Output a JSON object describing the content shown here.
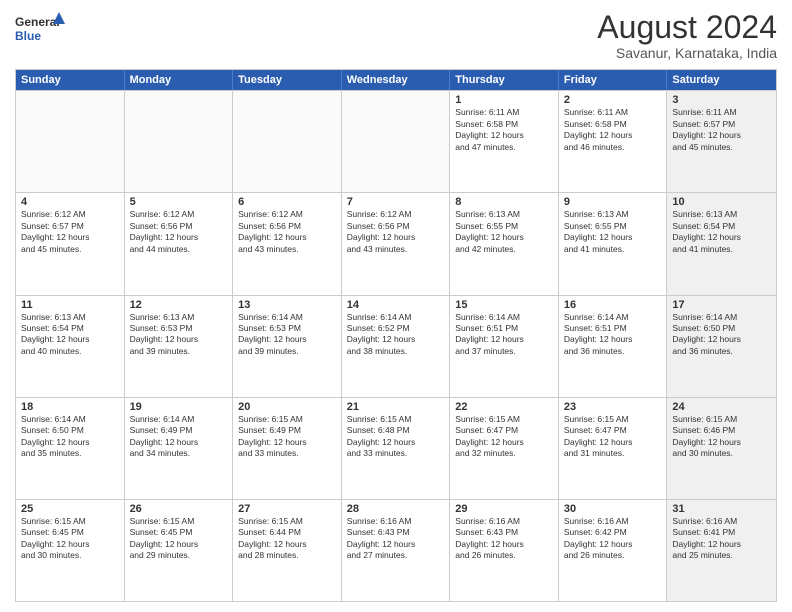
{
  "logo": {
    "line1": "General",
    "line2": "Blue"
  },
  "title": "August 2024",
  "location": "Savanur, Karnataka, India",
  "days": [
    "Sunday",
    "Monday",
    "Tuesday",
    "Wednesday",
    "Thursday",
    "Friday",
    "Saturday"
  ],
  "rows": [
    [
      {
        "num": "",
        "text": "",
        "empty": true
      },
      {
        "num": "",
        "text": "",
        "empty": true
      },
      {
        "num": "",
        "text": "",
        "empty": true
      },
      {
        "num": "",
        "text": "",
        "empty": true
      },
      {
        "num": "1",
        "text": "Sunrise: 6:11 AM\nSunset: 6:58 PM\nDaylight: 12 hours\nand 47 minutes."
      },
      {
        "num": "2",
        "text": "Sunrise: 6:11 AM\nSunset: 6:58 PM\nDaylight: 12 hours\nand 46 minutes."
      },
      {
        "num": "3",
        "text": "Sunrise: 6:11 AM\nSunset: 6:57 PM\nDaylight: 12 hours\nand 45 minutes.",
        "shaded": true
      }
    ],
    [
      {
        "num": "4",
        "text": "Sunrise: 6:12 AM\nSunset: 6:57 PM\nDaylight: 12 hours\nand 45 minutes."
      },
      {
        "num": "5",
        "text": "Sunrise: 6:12 AM\nSunset: 6:56 PM\nDaylight: 12 hours\nand 44 minutes."
      },
      {
        "num": "6",
        "text": "Sunrise: 6:12 AM\nSunset: 6:56 PM\nDaylight: 12 hours\nand 43 minutes."
      },
      {
        "num": "7",
        "text": "Sunrise: 6:12 AM\nSunset: 6:56 PM\nDaylight: 12 hours\nand 43 minutes."
      },
      {
        "num": "8",
        "text": "Sunrise: 6:13 AM\nSunset: 6:55 PM\nDaylight: 12 hours\nand 42 minutes."
      },
      {
        "num": "9",
        "text": "Sunrise: 6:13 AM\nSunset: 6:55 PM\nDaylight: 12 hours\nand 41 minutes."
      },
      {
        "num": "10",
        "text": "Sunrise: 6:13 AM\nSunset: 6:54 PM\nDaylight: 12 hours\nand 41 minutes.",
        "shaded": true
      }
    ],
    [
      {
        "num": "11",
        "text": "Sunrise: 6:13 AM\nSunset: 6:54 PM\nDaylight: 12 hours\nand 40 minutes."
      },
      {
        "num": "12",
        "text": "Sunrise: 6:13 AM\nSunset: 6:53 PM\nDaylight: 12 hours\nand 39 minutes."
      },
      {
        "num": "13",
        "text": "Sunrise: 6:14 AM\nSunset: 6:53 PM\nDaylight: 12 hours\nand 39 minutes."
      },
      {
        "num": "14",
        "text": "Sunrise: 6:14 AM\nSunset: 6:52 PM\nDaylight: 12 hours\nand 38 minutes."
      },
      {
        "num": "15",
        "text": "Sunrise: 6:14 AM\nSunset: 6:51 PM\nDaylight: 12 hours\nand 37 minutes."
      },
      {
        "num": "16",
        "text": "Sunrise: 6:14 AM\nSunset: 6:51 PM\nDaylight: 12 hours\nand 36 minutes."
      },
      {
        "num": "17",
        "text": "Sunrise: 6:14 AM\nSunset: 6:50 PM\nDaylight: 12 hours\nand 36 minutes.",
        "shaded": true
      }
    ],
    [
      {
        "num": "18",
        "text": "Sunrise: 6:14 AM\nSunset: 6:50 PM\nDaylight: 12 hours\nand 35 minutes."
      },
      {
        "num": "19",
        "text": "Sunrise: 6:14 AM\nSunset: 6:49 PM\nDaylight: 12 hours\nand 34 minutes."
      },
      {
        "num": "20",
        "text": "Sunrise: 6:15 AM\nSunset: 6:49 PM\nDaylight: 12 hours\nand 33 minutes."
      },
      {
        "num": "21",
        "text": "Sunrise: 6:15 AM\nSunset: 6:48 PM\nDaylight: 12 hours\nand 33 minutes."
      },
      {
        "num": "22",
        "text": "Sunrise: 6:15 AM\nSunset: 6:47 PM\nDaylight: 12 hours\nand 32 minutes."
      },
      {
        "num": "23",
        "text": "Sunrise: 6:15 AM\nSunset: 6:47 PM\nDaylight: 12 hours\nand 31 minutes."
      },
      {
        "num": "24",
        "text": "Sunrise: 6:15 AM\nSunset: 6:46 PM\nDaylight: 12 hours\nand 30 minutes.",
        "shaded": true
      }
    ],
    [
      {
        "num": "25",
        "text": "Sunrise: 6:15 AM\nSunset: 6:45 PM\nDaylight: 12 hours\nand 30 minutes."
      },
      {
        "num": "26",
        "text": "Sunrise: 6:15 AM\nSunset: 6:45 PM\nDaylight: 12 hours\nand 29 minutes."
      },
      {
        "num": "27",
        "text": "Sunrise: 6:15 AM\nSunset: 6:44 PM\nDaylight: 12 hours\nand 28 minutes."
      },
      {
        "num": "28",
        "text": "Sunrise: 6:16 AM\nSunset: 6:43 PM\nDaylight: 12 hours\nand 27 minutes."
      },
      {
        "num": "29",
        "text": "Sunrise: 6:16 AM\nSunset: 6:43 PM\nDaylight: 12 hours\nand 26 minutes."
      },
      {
        "num": "30",
        "text": "Sunrise: 6:16 AM\nSunset: 6:42 PM\nDaylight: 12 hours\nand 26 minutes."
      },
      {
        "num": "31",
        "text": "Sunrise: 6:16 AM\nSunset: 6:41 PM\nDaylight: 12 hours\nand 25 minutes.",
        "shaded": true
      }
    ]
  ]
}
